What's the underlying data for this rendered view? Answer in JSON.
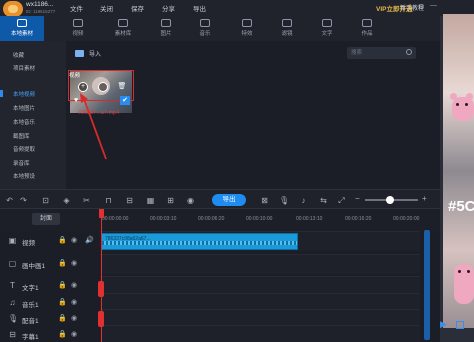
{
  "titlebar": {
    "account_name": "wx1186...",
    "account_id": "ID: 118615277",
    "menu": [
      "文件",
      "关闭",
      "保存",
      "分享",
      "导出"
    ],
    "vip": "VIP立即开通",
    "tutorial": "新手教程"
  },
  "nav": [
    {
      "label": "本地素材",
      "icon": "folder-icon"
    },
    {
      "label": "视频",
      "icon": "video-icon"
    },
    {
      "label": "素材库",
      "icon": "library-icon"
    },
    {
      "label": "图片",
      "icon": "image-icon"
    },
    {
      "label": "音乐",
      "icon": "music-icon"
    },
    {
      "label": "特效",
      "icon": "effects-icon"
    },
    {
      "label": "滤镜",
      "icon": "filter-icon"
    },
    {
      "label": "文字",
      "icon": "text-icon"
    },
    {
      "label": "作品",
      "icon": "works-icon"
    }
  ],
  "sidebar": {
    "items": [
      "收藏",
      "项目素材",
      "本地视频",
      "本地图片",
      "本地音乐",
      "截图库",
      "音频提取",
      "录音库",
      "本地预设"
    ],
    "active_index": 2
  },
  "media": {
    "import_label": "导入",
    "search_placeholder": "搜索",
    "thumb_tag": "视频",
    "thumb_caption": "786337...a7.mp4",
    "add_symbol": "+",
    "selected_symbol": "✔",
    "favorite_symbol": "♥"
  },
  "toolbar": {
    "export_label": "导出"
  },
  "timeline": {
    "cover_label": "封面",
    "ticks": [
      "00:00:00:00",
      "00:00:03:10",
      "00:00:06:20",
      "00:00:10:00",
      "00:00:13:10",
      "00:00:16:20",
      "00:00:20:00"
    ],
    "tracks": [
      {
        "name": "视频",
        "icon": "video-track-icon"
      },
      {
        "name": "画中画1",
        "icon": "pip-track-icon"
      },
      {
        "name": "文字1",
        "icon": "text-track-icon"
      },
      {
        "name": "音乐1",
        "icon": "music-track-icon"
      },
      {
        "name": "配音1",
        "icon": "voice-track-icon"
      },
      {
        "name": "字幕1",
        "icon": "subtitle-track-icon"
      }
    ],
    "clip_title": "786337c98a62a67..."
  },
  "preview": {
    "overlay_text": "#5C"
  },
  "colors": {
    "accent": "#1e8cf0",
    "active_nav": "#0f5aa8",
    "selection_red": "#d82a2a",
    "clip_blue": "#1a9ad8",
    "vip_gold": "#e6b84a"
  }
}
